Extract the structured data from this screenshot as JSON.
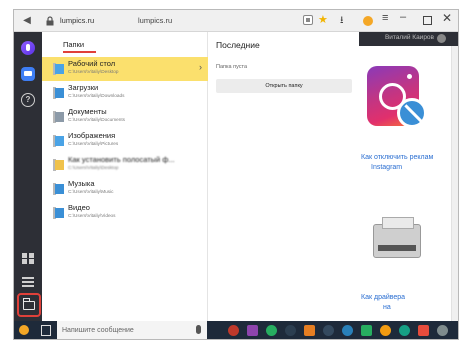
{
  "browser": {
    "url_host": "lumpics.ru",
    "page_title": "lumpics.ru"
  },
  "background_page": {
    "account_label": "Виталий Каиров",
    "links": [
      "Как отключить реклам",
      "Instagram",
      "Как драйвера",
      "на"
    ]
  },
  "folders_panel": {
    "title": "Папки",
    "items": [
      {
        "name": "Рабочий стол",
        "path": "C:\\Users\\Vitaliy\\Desktop",
        "color": "#4aa3e6"
      },
      {
        "name": "Загрузки",
        "path": "C:\\Users\\Vitaliy\\Downloads",
        "color": "#3a8fd6"
      },
      {
        "name": "Документы",
        "path": "C:\\Users\\Vitaliy\\Documents",
        "color": "#8c9aa8"
      },
      {
        "name": "Изображения",
        "path": "C:\\Users\\Vitaliy\\Pictures",
        "color": "#4aa3e6"
      },
      {
        "name": "Как установить полосатый ф...",
        "path": "C:\\Users\\Vitaliy\\Desktop",
        "color": "#f0c24b"
      },
      {
        "name": "Музыка",
        "path": "C:\\Users\\Vitaliy\\Music",
        "color": "#3a8fd6"
      },
      {
        "name": "Видео",
        "path": "C:\\Users\\Vitaliy\\Videos",
        "color": "#3a8fd6"
      }
    ]
  },
  "recent_panel": {
    "title": "Последние",
    "empty_text": "Папка пуста",
    "open_button_label": "Открыть папку"
  },
  "taskbar": {
    "search_placeholder": "Напишите сообщение",
    "apps": [
      "#c0392b",
      "#8e44ad",
      "#27ae60",
      "#2c3e50",
      "#e67e22",
      "#34495e",
      "#2980b9",
      "#27ae60",
      "#f39c12",
      "#16a085",
      "#e74c3c",
      "#7f8c8d"
    ]
  },
  "colors": {
    "accent_red": "#e0413a",
    "selected_yellow": "#fbe06d",
    "sidebar_dark": "#2d2f36"
  }
}
